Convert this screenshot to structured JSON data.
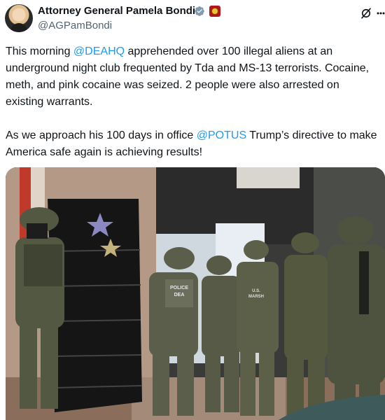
{
  "author": {
    "name": "Attorney General Pamela Bondi",
    "handle": "@AGPamBondi",
    "avatar_icon": "profile-avatar",
    "verified_icon": "verified-check-icon",
    "affiliation_icon": "government-seal-icon"
  },
  "header_actions": {
    "grok_icon": "grok-icon",
    "more_icon": "more-options-icon"
  },
  "tweet": {
    "p1_part1": "This morning ",
    "p1_mention": "@DEAHQ",
    "p1_part2": " apprehended over 100 illegal aliens at an underground night club frequented by Tda and MS-13 terrorists. Cocaine, meth, and pink cocaine was seized. 2 people were also arrested on existing warrants.",
    "p2_part1": "As we approach his 100 days in office ",
    "p2_mention": "@POTUS",
    "p2_part2": " Trump’s directive to make America safe again is achieving results!"
  },
  "media": {
    "vest_labels": [
      {
        "line1": "POLICE",
        "line2": "DEA"
      },
      {
        "line1": "U.S.",
        "line2": "MARSH"
      }
    ]
  },
  "colors": {
    "mention": "#1d9bf0",
    "text": "#0f1419",
    "secondary": "#536471",
    "verified": "#829aab"
  }
}
